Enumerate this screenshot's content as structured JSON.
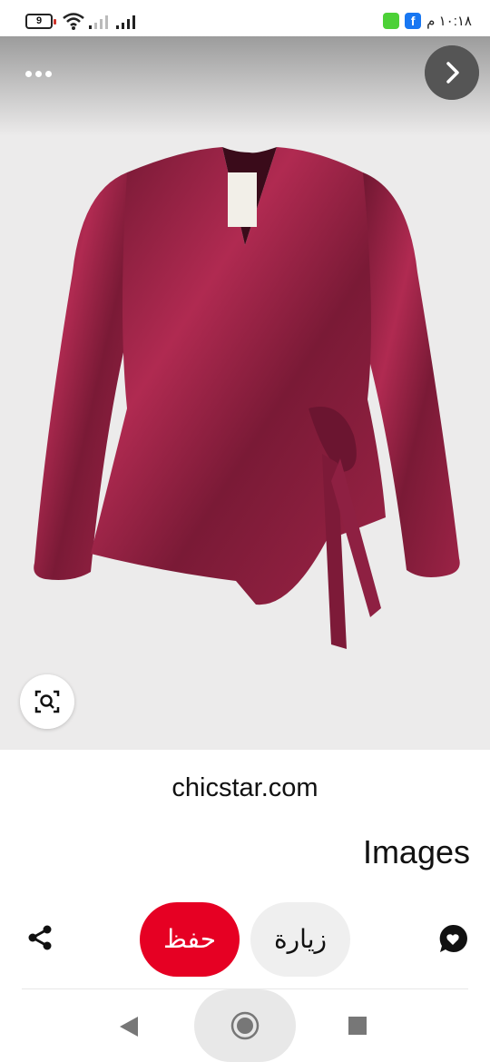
{
  "status_bar": {
    "battery_level": "9",
    "time": "١٠:١٨ م",
    "fb_badge": "f"
  },
  "pin": {
    "source_domain": "chicstar.com",
    "board_name": "Images",
    "image_subject": "burgundy wrap blouse"
  },
  "actions": {
    "save_label": "حفظ",
    "visit_label": "زيارة"
  },
  "colors": {
    "save_red": "#e60023",
    "visit_gray": "#efefef",
    "blouse": "#8c1f3c"
  },
  "icons": {
    "more": "more-icon",
    "next": "chevron-right-icon",
    "lens": "visual-search-icon",
    "share": "share-icon",
    "comment": "comment-icon"
  }
}
